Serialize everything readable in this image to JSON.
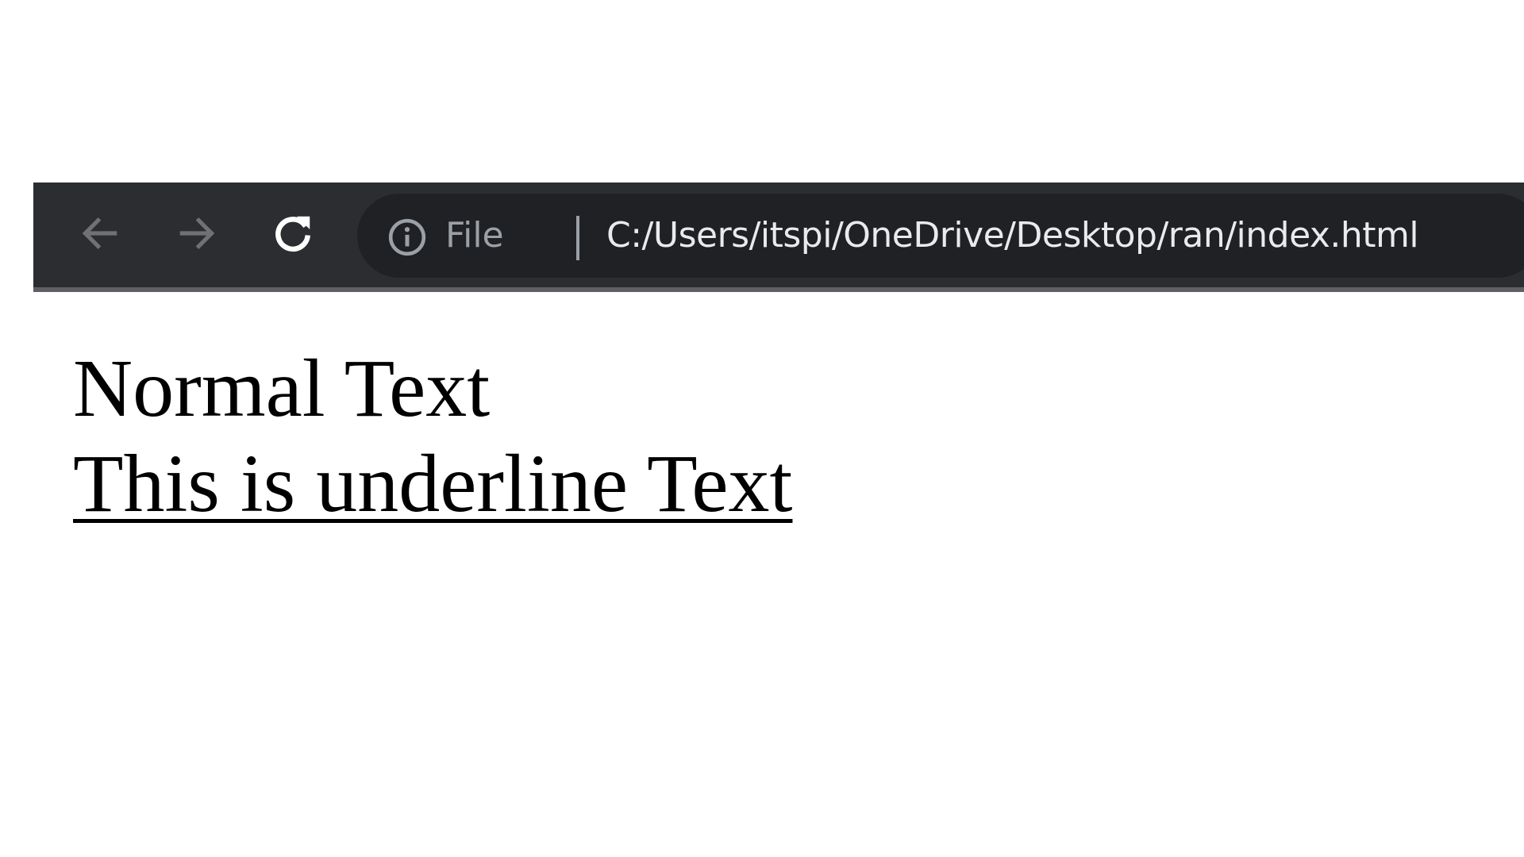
{
  "toolbar": {
    "back_icon": "arrow-left-icon",
    "forward_icon": "arrow-right-icon",
    "reload_icon": "reload-icon",
    "colors": {
      "toolbar_bg": "#2c2d30",
      "omnibox_bg": "#202124",
      "disabled_icon": "#6f7175",
      "active_icon": "#ffffff",
      "muted_text": "#9aa0a6",
      "url_text": "#e8eaed"
    }
  },
  "omnibox": {
    "security_icon": "info-icon",
    "scheme_label": "File",
    "url": "C:/Users/itspi/OneDrive/Desktop/ran/index.html"
  },
  "page": {
    "normal_text": "Normal Text",
    "underline_text": "This is underline Text"
  }
}
